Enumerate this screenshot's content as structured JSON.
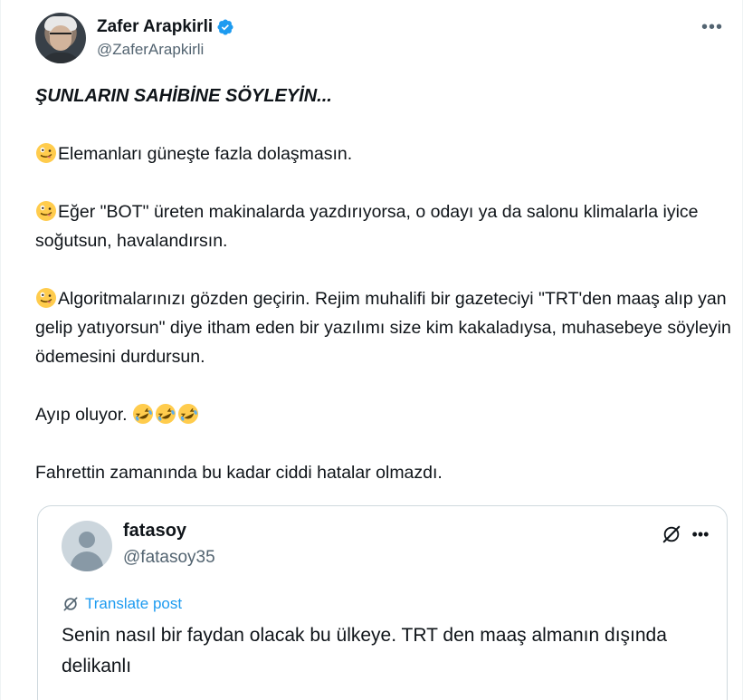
{
  "author": {
    "display_name": "Zafer Arapkirli",
    "handle": "@ZaferArapkirli",
    "verified": true
  },
  "icons": {
    "more": "more-horizontal-icon",
    "verified": "verified-badge-icon",
    "emoji_tongue": "zany-face-emoji",
    "emoji_laugh": "rolling-on-floor-laughing-emoji",
    "grok": "grok-icon",
    "translate": "translate-icon"
  },
  "colors": {
    "accent": "#1d9bf0",
    "secondary_text": "#536471",
    "border": "#cfd9de"
  },
  "post": {
    "headline": "ŞUNLARIN SAHİBİNE SÖYLEYİN...",
    "item1": "Elemanları güneşte fazla dolaşmasın.",
    "item2": "Eğer \"BOT\" üreten makinalarda yazdırıyorsa, o odayı ya da salonu klimalarla iyice soğutsun, havalandırsın.",
    "item3": "Algoritmalarınızı gözden geçirin. Rejim muhalifi bir gazeteciyi \"TRT'den maaş alıp yan gelip yatıyorsun\" diye itham eden bir yazılımı size kim kakaladıysa, muhasebeye söyleyin ödemesini durdursun.",
    "shame": "Ayıp oluyor.",
    "closing": "Fahrettin zamanında bu kadar ciddi hatalar olmazdı."
  },
  "quoted": {
    "display_name": "fatasoy",
    "handle": "@fatasoy35",
    "translate_label": "Translate post",
    "text": "Senin nasıl bir faydan olacak bu ülkeye. TRT den maaş almanın dışında delikanlı"
  }
}
